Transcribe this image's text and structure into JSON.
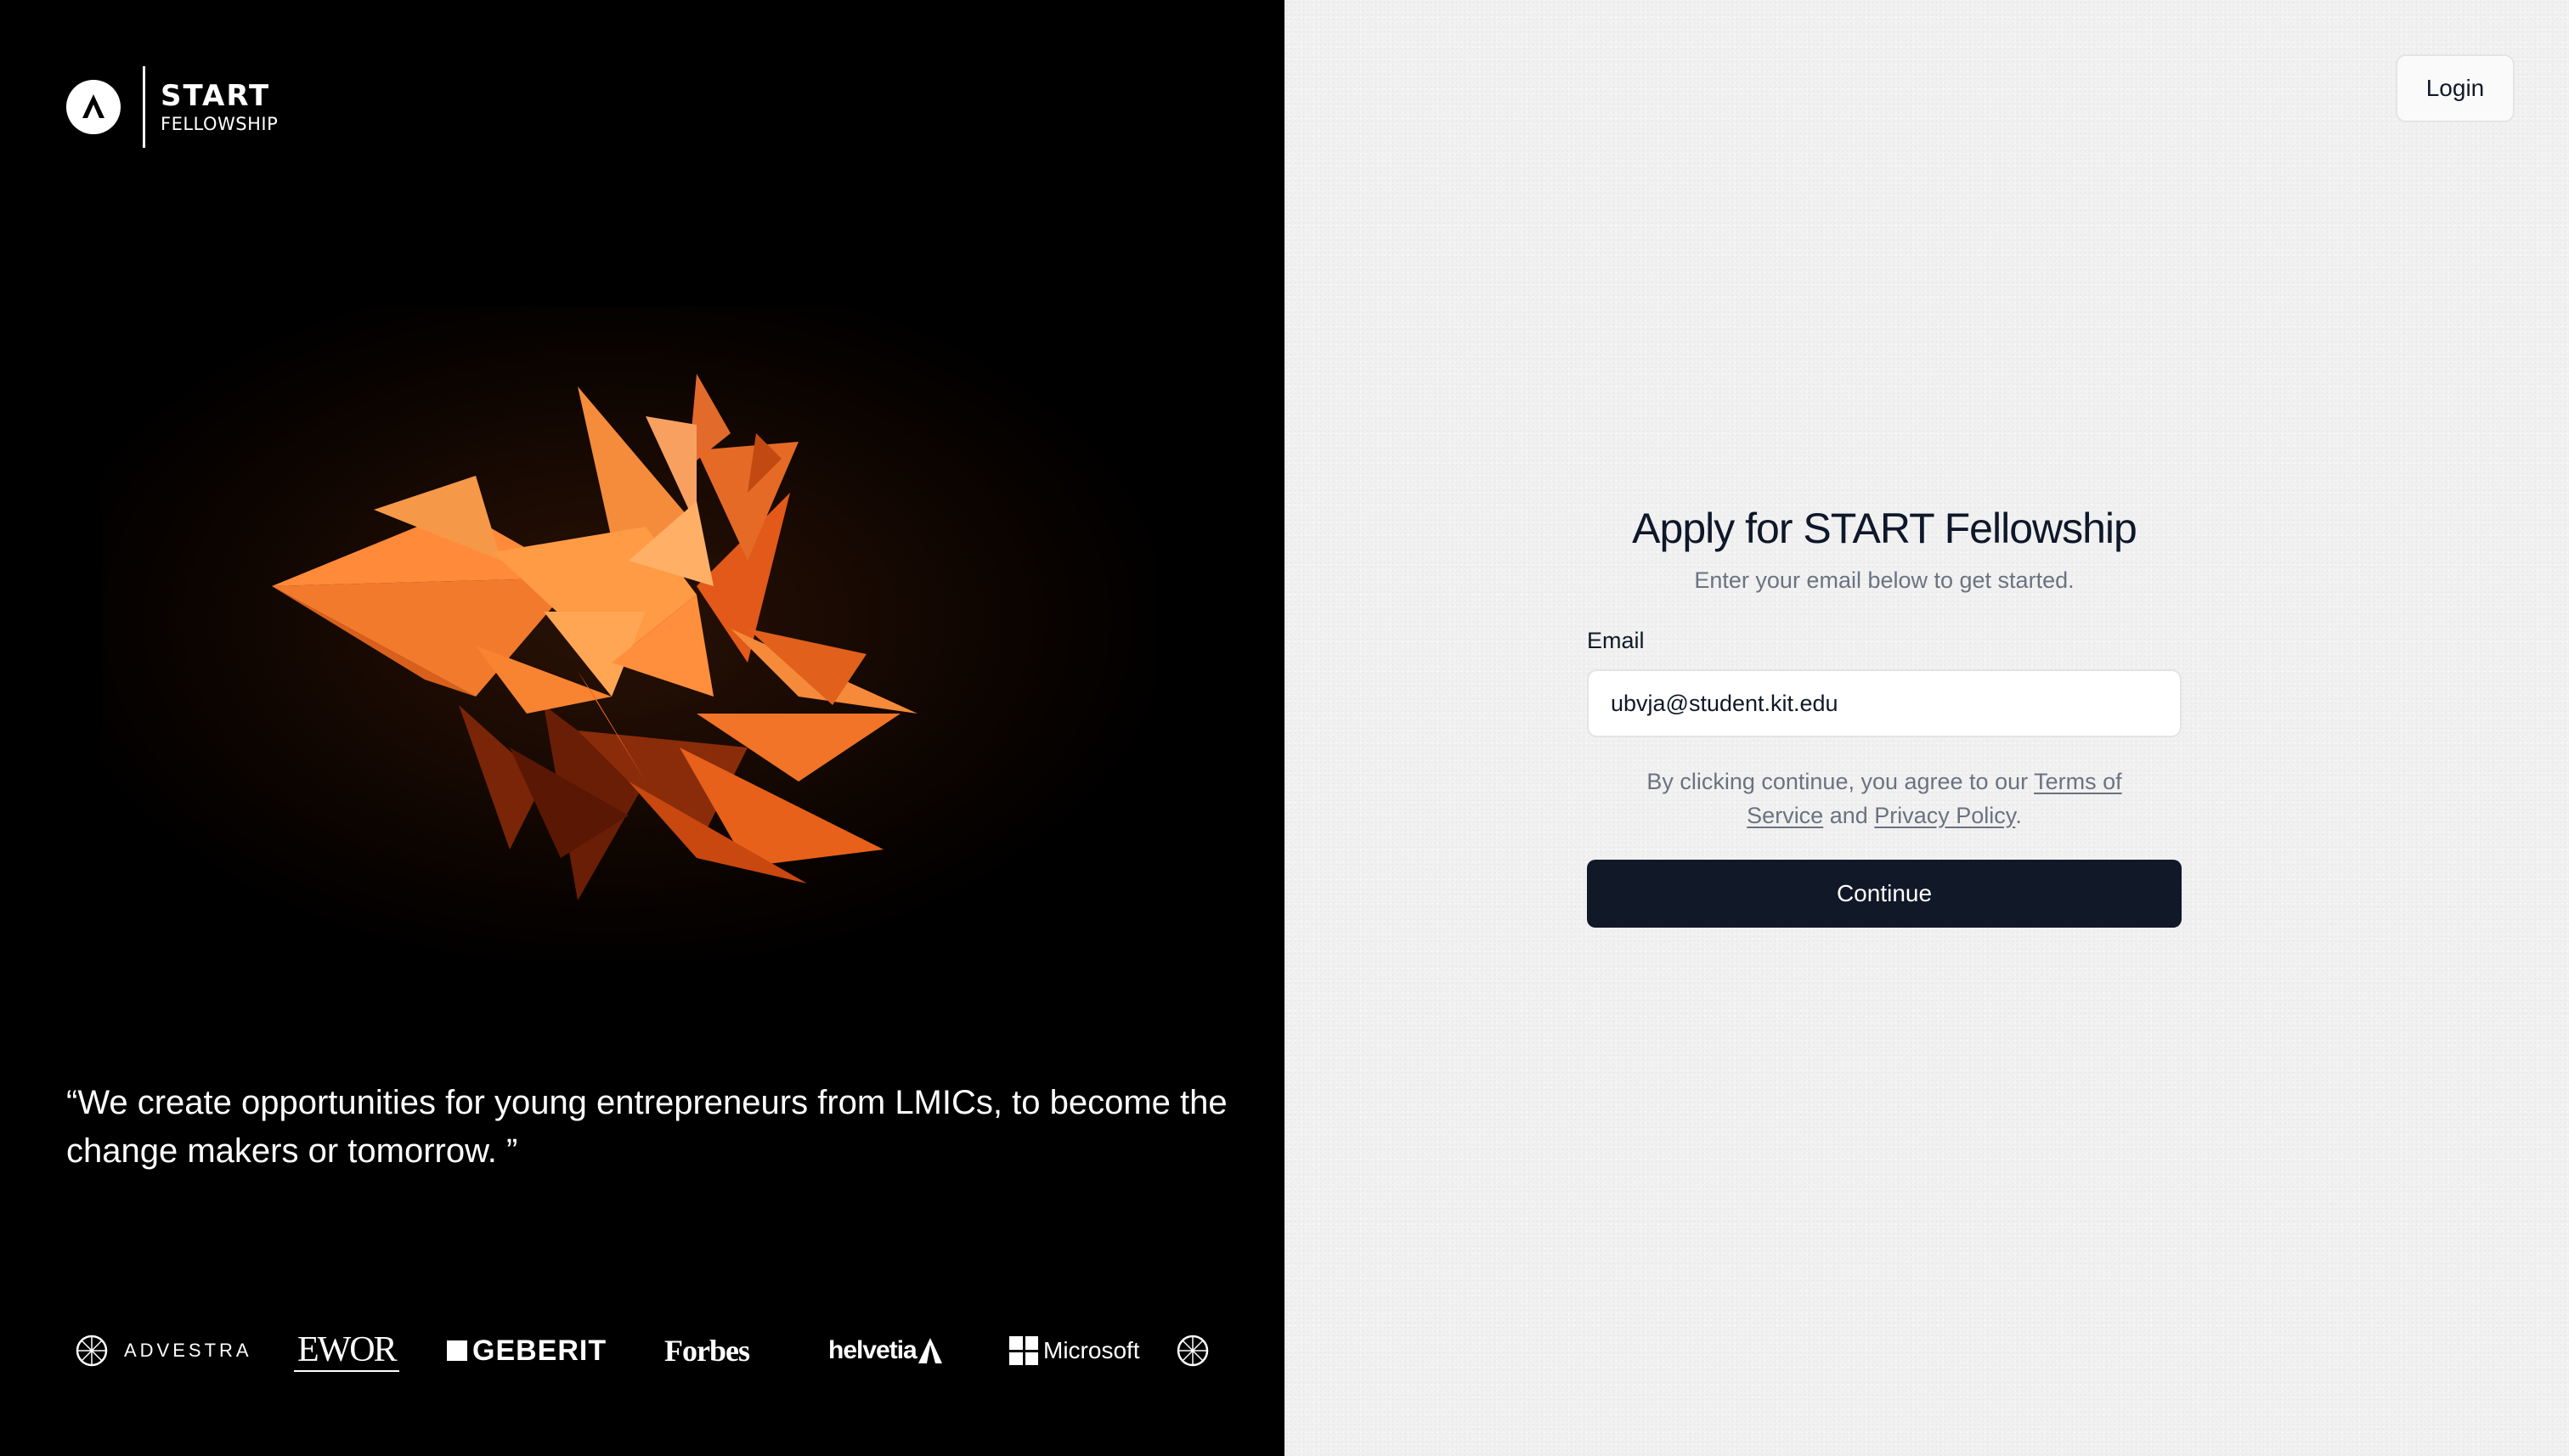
{
  "brand": {
    "title": "START",
    "subtitle": "FELLOWSHIP",
    "logo_icon": "start-fellowship-logo-icon"
  },
  "hero": {
    "quote": "“We create opportunities for young entrepreneurs from LMICs, to become the change makers or tomorrow. ”"
  },
  "partners": [
    {
      "name": "ADVESTRA"
    },
    {
      "name": "EWOR"
    },
    {
      "name": "GEBERIT"
    },
    {
      "name": "Forbes"
    },
    {
      "name": "helvetia"
    },
    {
      "name": "Microsoft"
    }
  ],
  "header": {
    "login_label": "Login"
  },
  "form": {
    "title": "Apply for START Fellowship",
    "subtitle": "Enter your email below to get started.",
    "email_label": "Email",
    "email_value": "ubvja@student.kit.edu",
    "terms_prefix": "By clicking continue, you agree to our ",
    "terms_link": "Terms of Service",
    "terms_and": " and ",
    "privacy_link": "Privacy Policy",
    "terms_suffix": ".",
    "continue_label": "Continue"
  },
  "colors": {
    "left_bg": "#000000",
    "right_bg": "#f1f1f1",
    "primary_button": "#111827",
    "accent_orange": "#f57c24"
  }
}
